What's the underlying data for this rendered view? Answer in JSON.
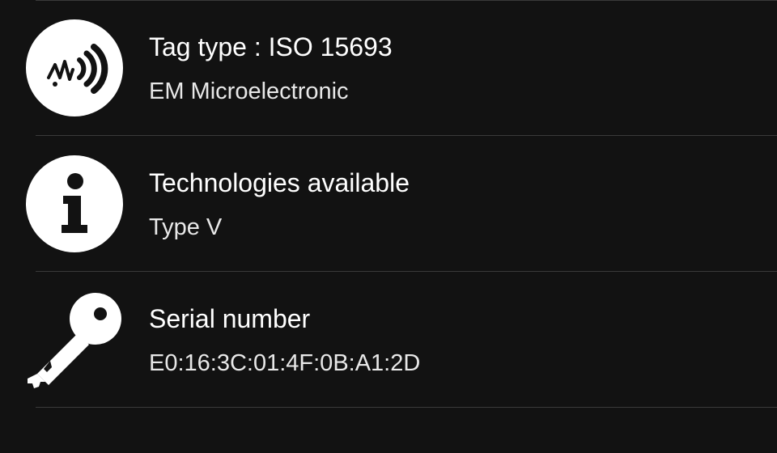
{
  "items": [
    {
      "icon": "nfc-wave-icon",
      "title": "Tag type : ISO 15693",
      "subtitle": "EM Microelectronic"
    },
    {
      "icon": "info-icon",
      "title": "Technologies available",
      "subtitle": "Type V"
    },
    {
      "icon": "key-icon",
      "title": "Serial number",
      "subtitle": "E0:16:3C:01:4F:0B:A1:2D"
    }
  ],
  "colors": {
    "background": "#121212",
    "divider": "#3a3a3a",
    "text": "#ffffff"
  }
}
